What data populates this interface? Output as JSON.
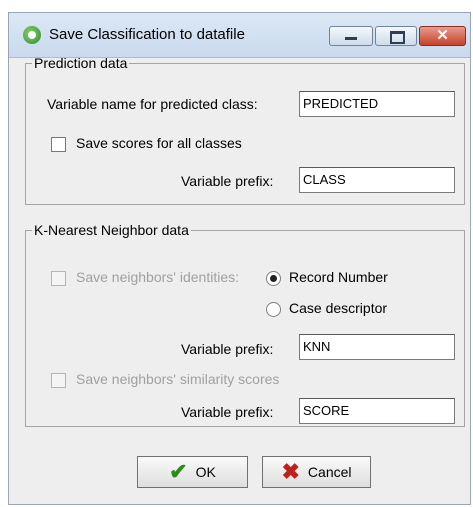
{
  "window": {
    "title": "Save Classification to datafile",
    "icon": "app-icon",
    "controls": {
      "minimize": "minimize-icon",
      "maximize": "maximize-icon",
      "close": "close-icon",
      "close_glyph": "✕"
    }
  },
  "prediction": {
    "legend": "Prediction data",
    "var_name_label": "Variable name for predicted class:",
    "var_name_value": "PREDICTED",
    "save_scores_label": "Save scores for all classes",
    "save_scores_checked": false,
    "prefix_label": "Variable prefix:",
    "prefix_value": "CLASS"
  },
  "knn": {
    "legend": "K-Nearest Neighbor data",
    "save_identities_label": "Save neighbors' identities:",
    "save_identities_checked": false,
    "identity_options": [
      {
        "label": "Record Number",
        "selected": true
      },
      {
        "label": "Case descriptor",
        "selected": false
      }
    ],
    "prefix_label": "Variable prefix:",
    "prefix_value": "KNN",
    "save_similarity_label": "Save neighbors' similarity scores",
    "save_similarity_checked": false,
    "score_prefix_label": "Variable prefix:",
    "score_prefix_value": "SCORE"
  },
  "buttons": {
    "ok_label": "OK",
    "cancel_label": "Cancel",
    "ok_icon": "checkmark-icon",
    "cancel_icon": "cross-icon"
  },
  "colors": {
    "ok_icon": "#2e8b1e",
    "cancel_icon": "#c0201a",
    "disabled_text": "#a0a0a0"
  }
}
